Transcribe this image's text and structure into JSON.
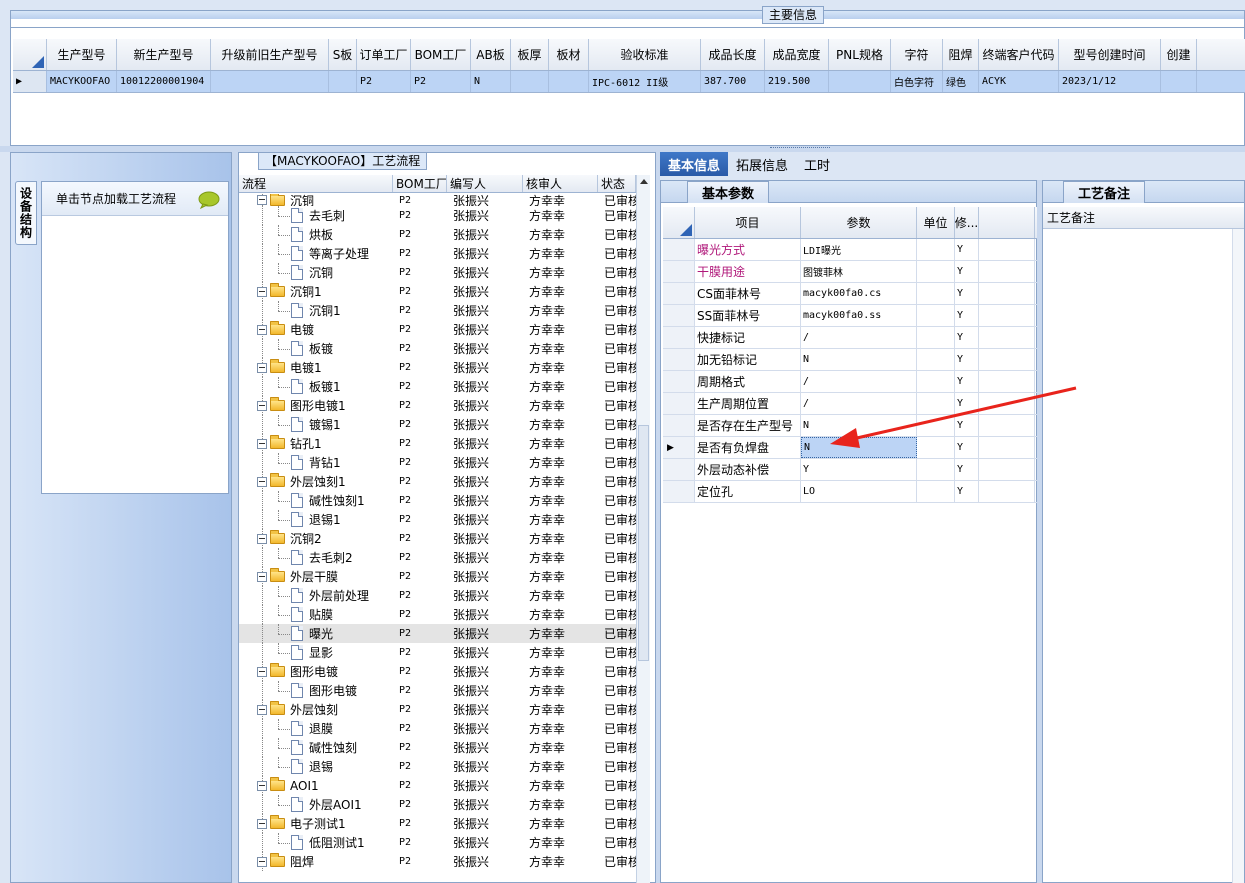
{
  "main_info": {
    "legend": "主要信息",
    "columns": [
      "生产型号",
      "新生产型号",
      "升级前旧生产型号",
      "S板",
      "订单工厂",
      "BOM工厂",
      "AB板",
      "板厚",
      "板材",
      "验收标准",
      "成品长度",
      "成品宽度",
      "PNL规格",
      "字符",
      "阻焊",
      "终端客户代码",
      "型号创建时间",
      "创建"
    ],
    "row": {
      "indicator": "▶",
      "cells": [
        "MACYKOOFAO",
        "10012200001904",
        "",
        "",
        "P2",
        "P2",
        "N",
        "",
        "",
        "IPC-6012 II级",
        "387.700",
        "219.500",
        "",
        "白色字符",
        "绿色",
        "ACYK",
        "2023/1/12",
        ""
      ]
    }
  },
  "left_panel": {
    "vertical_tab": "设备结构",
    "header": "单击节点加载工艺流程",
    "chat_icon": "chat-bubble-icon"
  },
  "process_flow": {
    "legend": "【MACYKOOFAO】工艺流程",
    "columns": [
      "流程",
      "BOM工厂",
      "编写人",
      "核审人",
      "状态"
    ],
    "rows": [
      {
        "level": 1,
        "name": "沉铜",
        "bom": "P2",
        "writer": "张振兴",
        "reviewer": "方幸幸",
        "status": "已审核",
        "partial": true
      },
      {
        "level": 2,
        "name": "去毛刺",
        "bom": "P2",
        "writer": "张振兴",
        "reviewer": "方幸幸",
        "status": "已审核"
      },
      {
        "level": 2,
        "name": "烘板",
        "bom": "P2",
        "writer": "张振兴",
        "reviewer": "方幸幸",
        "status": "已审核"
      },
      {
        "level": 2,
        "name": "等离子处理",
        "bom": "P2",
        "writer": "张振兴",
        "reviewer": "方幸幸",
        "status": "已审核"
      },
      {
        "level": 2,
        "name": "沉铜",
        "bom": "P2",
        "writer": "张振兴",
        "reviewer": "方幸幸",
        "status": "已审核"
      },
      {
        "level": 1,
        "name": "沉铜1",
        "bom": "P2",
        "writer": "张振兴",
        "reviewer": "方幸幸",
        "status": "已审核"
      },
      {
        "level": 2,
        "name": "沉铜1",
        "bom": "P2",
        "writer": "张振兴",
        "reviewer": "方幸幸",
        "status": "已审核"
      },
      {
        "level": 1,
        "name": "电镀",
        "bom": "P2",
        "writer": "张振兴",
        "reviewer": "方幸幸",
        "status": "已审核"
      },
      {
        "level": 2,
        "name": "板镀",
        "bom": "P2",
        "writer": "张振兴",
        "reviewer": "方幸幸",
        "status": "已审核"
      },
      {
        "level": 1,
        "name": "电镀1",
        "bom": "P2",
        "writer": "张振兴",
        "reviewer": "方幸幸",
        "status": "已审核"
      },
      {
        "level": 2,
        "name": "板镀1",
        "bom": "P2",
        "writer": "张振兴",
        "reviewer": "方幸幸",
        "status": "已审核"
      },
      {
        "level": 1,
        "name": "图形电镀1",
        "bom": "P2",
        "writer": "张振兴",
        "reviewer": "方幸幸",
        "status": "已审核"
      },
      {
        "level": 2,
        "name": "镀锡1",
        "bom": "P2",
        "writer": "张振兴",
        "reviewer": "方幸幸",
        "status": "已审核"
      },
      {
        "level": 1,
        "name": "钻孔1",
        "bom": "P2",
        "writer": "张振兴",
        "reviewer": "方幸幸",
        "status": "已审核"
      },
      {
        "level": 2,
        "name": "背钻1",
        "bom": "P2",
        "writer": "张振兴",
        "reviewer": "方幸幸",
        "status": "已审核"
      },
      {
        "level": 1,
        "name": "外层蚀刻1",
        "bom": "P2",
        "writer": "张振兴",
        "reviewer": "方幸幸",
        "status": "已审核"
      },
      {
        "level": 2,
        "name": "碱性蚀刻1",
        "bom": "P2",
        "writer": "张振兴",
        "reviewer": "方幸幸",
        "status": "已审核"
      },
      {
        "level": 2,
        "name": "退锡1",
        "bom": "P2",
        "writer": "张振兴",
        "reviewer": "方幸幸",
        "status": "已审核"
      },
      {
        "level": 1,
        "name": "沉铜2",
        "bom": "P2",
        "writer": "张振兴",
        "reviewer": "方幸幸",
        "status": "已审核"
      },
      {
        "level": 2,
        "name": "去毛刺2",
        "bom": "P2",
        "writer": "张振兴",
        "reviewer": "方幸幸",
        "status": "已审核"
      },
      {
        "level": 1,
        "name": "外层干膜",
        "bom": "P2",
        "writer": "张振兴",
        "reviewer": "方幸幸",
        "status": "已审核"
      },
      {
        "level": 2,
        "name": "外层前处理",
        "bom": "P2",
        "writer": "张振兴",
        "reviewer": "方幸幸",
        "status": "已审核"
      },
      {
        "level": 2,
        "name": "贴膜",
        "bom": "P2",
        "writer": "张振兴",
        "reviewer": "方幸幸",
        "status": "已审核"
      },
      {
        "level": 2,
        "name": "曝光",
        "bom": "P2",
        "writer": "张振兴",
        "reviewer": "方幸幸",
        "status": "已审核",
        "selected": true
      },
      {
        "level": 2,
        "name": "显影",
        "bom": "P2",
        "writer": "张振兴",
        "reviewer": "方幸幸",
        "status": "已审核"
      },
      {
        "level": 1,
        "name": "图形电镀",
        "bom": "P2",
        "writer": "张振兴",
        "reviewer": "方幸幸",
        "status": "已审核"
      },
      {
        "level": 2,
        "name": "图形电镀",
        "bom": "P2",
        "writer": "张振兴",
        "reviewer": "方幸幸",
        "status": "已审核"
      },
      {
        "level": 1,
        "name": "外层蚀刻",
        "bom": "P2",
        "writer": "张振兴",
        "reviewer": "方幸幸",
        "status": "已审核"
      },
      {
        "level": 2,
        "name": "退膜",
        "bom": "P2",
        "writer": "张振兴",
        "reviewer": "方幸幸",
        "status": "已审核"
      },
      {
        "level": 2,
        "name": "碱性蚀刻",
        "bom": "P2",
        "writer": "张振兴",
        "reviewer": "方幸幸",
        "status": "已审核"
      },
      {
        "level": 2,
        "name": "退锡",
        "bom": "P2",
        "writer": "张振兴",
        "reviewer": "方幸幸",
        "status": "已审核"
      },
      {
        "level": 1,
        "name": "AOI1",
        "bom": "P2",
        "writer": "张振兴",
        "reviewer": "方幸幸",
        "status": "已审核"
      },
      {
        "level": 2,
        "name": "外层AOI1",
        "bom": "P2",
        "writer": "张振兴",
        "reviewer": "方幸幸",
        "status": "已审核"
      },
      {
        "level": 1,
        "name": "电子测试1",
        "bom": "P2",
        "writer": "张振兴",
        "reviewer": "方幸幸",
        "status": "已审核"
      },
      {
        "level": 2,
        "name": "低阻测试1",
        "bom": "P2",
        "writer": "张振兴",
        "reviewer": "方幸幸",
        "status": "已审核"
      },
      {
        "level": 1,
        "name": "阻焊",
        "bom": "P2",
        "writer": "张振兴",
        "reviewer": "方幸幸",
        "status": "已审核"
      }
    ]
  },
  "right_tabs": [
    "基本信息",
    "拓展信息",
    "工时"
  ],
  "basic_params": {
    "subtab": "基本参数",
    "columns": [
      "项目",
      "参数",
      "单位",
      "修..."
    ],
    "rows": [
      {
        "item": "曝光方式",
        "value": "LDI曝光",
        "unit": "",
        "mod": "Y",
        "highlight": true
      },
      {
        "item": "干膜用途",
        "value": "图镀菲林",
        "unit": "",
        "mod": "Y",
        "highlight": true
      },
      {
        "item": "CS面菲林号",
        "value": "macyk00fa0.cs",
        "unit": "",
        "mod": "Y"
      },
      {
        "item": "SS面菲林号",
        "value": "macyk00fa0.ss",
        "unit": "",
        "mod": "Y"
      },
      {
        "item": "快捷标记",
        "value": "/",
        "unit": "",
        "mod": "Y"
      },
      {
        "item": "加无铅标记",
        "value": "N",
        "unit": "",
        "mod": "Y"
      },
      {
        "item": "周期格式",
        "value": "/",
        "unit": "",
        "mod": "Y"
      },
      {
        "item": "生产周期位置",
        "value": "/",
        "unit": "",
        "mod": "Y"
      },
      {
        "item": "是否存在生产型号",
        "value": "N",
        "unit": "",
        "mod": "Y"
      },
      {
        "item": "是否有负焊盘",
        "value": "N",
        "unit": "",
        "mod": "Y",
        "current": true,
        "indicator": "▶"
      },
      {
        "item": "外层动态补偿",
        "value": "Y",
        "unit": "",
        "mod": "Y"
      },
      {
        "item": "定位孔",
        "value": "LO",
        "unit": "",
        "mod": "Y"
      }
    ]
  },
  "process_notes": {
    "subtab": "工艺备注",
    "column": "工艺备注"
  },
  "colors": {
    "accent_blue": "#2a5aa7",
    "selected_row": "#bcd4f5",
    "highlight_text": "#b0187a",
    "annotation_arrow": "#e8241c"
  }
}
